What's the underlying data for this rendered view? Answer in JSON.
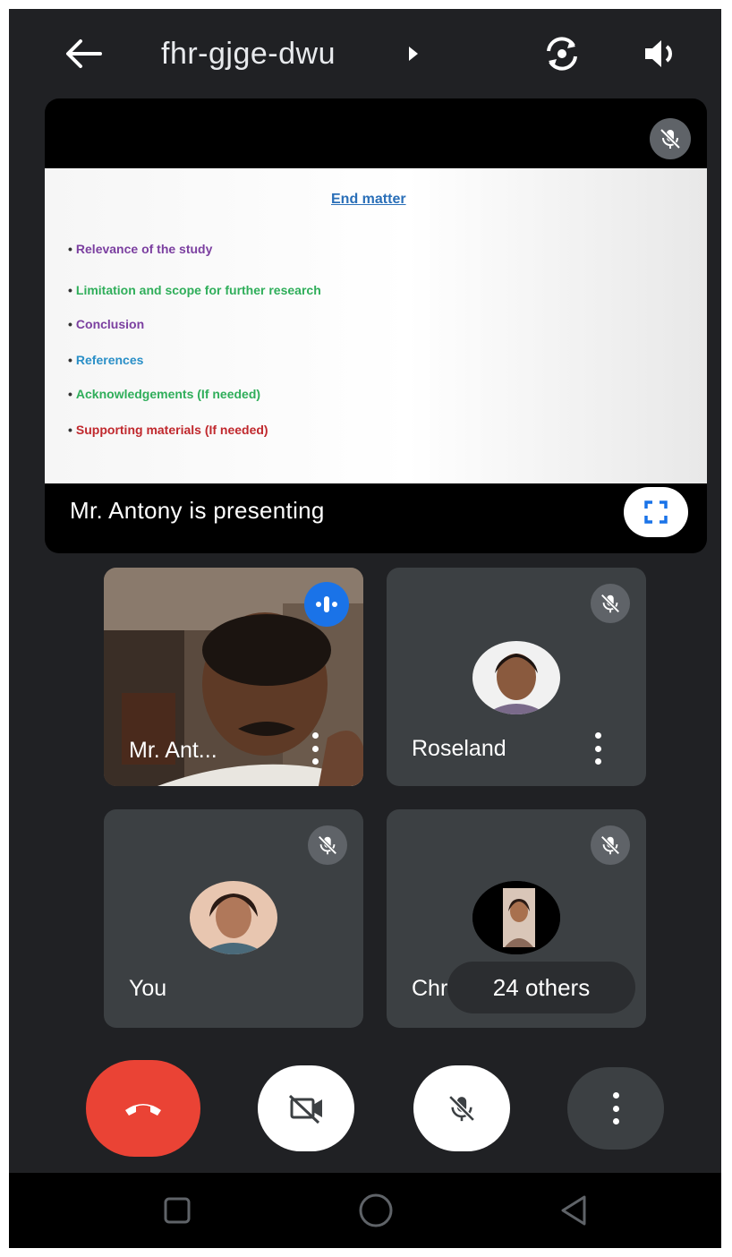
{
  "header": {
    "meeting_code": "fhr-gjge-dwu",
    "icons": [
      "arrow-left-icon",
      "caret-right-icon",
      "switch-camera-icon",
      "speaker-icon"
    ]
  },
  "presentation": {
    "slide": {
      "title": "End matter",
      "items": [
        {
          "text": "Relevance of the study",
          "color": "#7b3fa0"
        },
        {
          "text": "Limitation and scope for further research",
          "color": "#2fae5a"
        },
        {
          "text": "Conclusion",
          "color": "#7b3fa0"
        },
        {
          "text": "References",
          "color": "#2a8fc7"
        },
        {
          "text": "Acknowledgements (If needed)",
          "color": "#2fae5a"
        },
        {
          "text": "Supporting materials (If needed)",
          "color": "#c0282d"
        }
      ]
    },
    "status": "Mr. Antony is presenting"
  },
  "participants": [
    {
      "name": "Mr. Ant...",
      "state": "speaking"
    },
    {
      "name": "Roseland",
      "state": "muted"
    },
    {
      "name": "You",
      "state": "muted"
    },
    {
      "name": "Chri",
      "state": "muted"
    }
  ],
  "others_chip": "24 others",
  "controls": [
    "end-call-icon",
    "camera-off-icon",
    "mic-off-icon",
    "more-vert-icon"
  ],
  "colors": {
    "background": "#202124",
    "tile": "#3c4043",
    "end_call": "#ea4335",
    "speaking": "#1a73e8"
  }
}
